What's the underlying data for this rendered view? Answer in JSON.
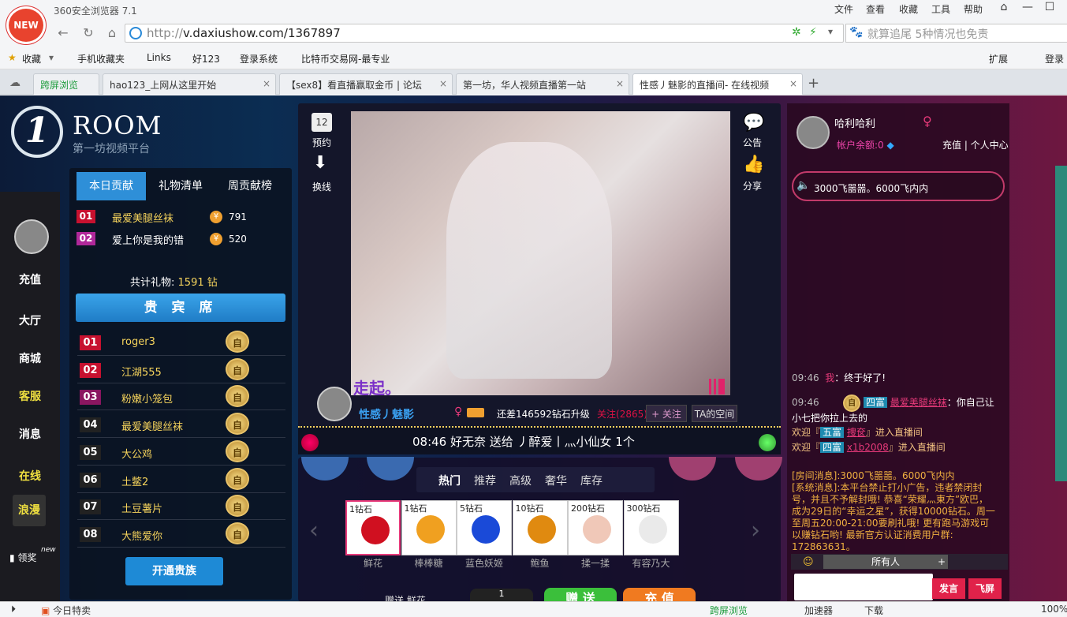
{
  "browser": {
    "app_title": "360安全浏览器 7.1",
    "logo_text": "NEW",
    "menus": [
      "文件",
      "查看",
      "收藏",
      "工具",
      "帮助"
    ],
    "url_prefix": "http://",
    "url_body": "v.daxiushow.com/1367897",
    "search_text": "就算追尾 5种情况也免责",
    "favorites": [
      "收藏",
      "手机收藏夹",
      "Links",
      "好123",
      "登录系统",
      "比特币交易网-最专业"
    ],
    "fav_right": [
      "扩展",
      "登录"
    ],
    "tabs": [
      {
        "label": "跨屏浏览"
      },
      {
        "label": "hao123_上网从这里开始"
      },
      {
        "label": "【sex8】看直播赢取金币 | 论坛"
      },
      {
        "label": "第一坊，华人视频直播第一站"
      },
      {
        "label": "性感丿魅影的直播间- 在线视频"
      }
    ],
    "status": {
      "left": "今日特卖",
      "cross": "跨屏浏览",
      "accel": "加速器",
      "download": "下载",
      "zoom": "100%"
    }
  },
  "site": {
    "logo_glyph": "1",
    "room_title": "ROOM",
    "room_subtitle": "第一坊视频平台",
    "sidebar": [
      "充值",
      "大厅",
      "商城",
      "客服",
      "消息",
      "在线",
      "浪漫",
      "领奖"
    ],
    "sidebar_new": "new"
  },
  "contrib": {
    "tabs": [
      "本日贡献",
      "礼物清单",
      "周贡献榜"
    ],
    "rows": [
      {
        "rank": "01",
        "name": "最爱美腿丝袜",
        "value": "791"
      },
      {
        "rank": "02",
        "name": "爱上你是我的错",
        "value": "520"
      }
    ],
    "coin_glyph": "¥",
    "total_label": "共计礼物:",
    "total_value": "1591",
    "total_unit": "钻",
    "vip_title": "贵 宾 席",
    "vip_badge": "自",
    "vip": [
      {
        "rank": "01",
        "name": "roger3"
      },
      {
        "rank": "02",
        "name": "江湖555"
      },
      {
        "rank": "03",
        "name": "粉嫩小笼包"
      },
      {
        "rank": "04",
        "name": "最爱美腿丝袜"
      },
      {
        "rank": "05",
        "name": "大公鸡"
      },
      {
        "rank": "06",
        "name": "土鳖2"
      },
      {
        "rank": "07",
        "name": "土豆薯片"
      },
      {
        "rank": "08",
        "name": "大熊爱你"
      }
    ],
    "vip_button": "开通贵族"
  },
  "stage": {
    "left_icons": [
      {
        "label": "预约"
      },
      {
        "label": "换线"
      }
    ],
    "right_icons": [
      {
        "label": "公告"
      },
      {
        "label": "分享"
      }
    ],
    "video_caption": "走起。",
    "host_name": "性感丿魅影",
    "upgrade_text": "还差146592钻石升级",
    "follow_text": "关注",
    "follow_count": "(2865)",
    "follow_button": "+ 关注",
    "space_button": "TA的空间",
    "marquee": "08:46  好无奈 送给 丿醉爱丨灬小仙女   1个"
  },
  "gifts": {
    "categories": [
      "热门",
      "推荐",
      "高级",
      "奢华",
      "库存"
    ],
    "items": [
      {
        "price": "1钻石",
        "name": "鲜花",
        "color": "#d01020"
      },
      {
        "price": "1钻石",
        "name": "棒棒糖",
        "color": "#f0a020"
      },
      {
        "price": "5钻石",
        "name": "蓝色妖姬",
        "color": "#1a4ad8"
      },
      {
        "price": "10钻石",
        "name": "鲍鱼",
        "color": "#e08a10"
      },
      {
        "price": "200钻石",
        "name": "揉一揉",
        "color": "#f0c8b8"
      },
      {
        "price": "300钻石",
        "name": "有容乃大",
        "color": "#eaeaea"
      }
    ],
    "send_label": "赠送",
    "send_gift": "鲜花",
    "send_qty": "1",
    "send_button": "赠 送",
    "charge_button": "充 值"
  },
  "chatpanel": {
    "username": "哈利哈利",
    "gender": "♀",
    "balance": "帐户余额:0",
    "links": "充值 | 个人中心",
    "speaker": "3000飞噐噐。6000飞内内",
    "messages": {
      "m1_time": "09:46",
      "m1_name": "我",
      "m1_text": "：终于好了!",
      "m2_time": "09:46",
      "m2_badge": "自",
      "m2_level": "四富",
      "m2_name": "最爱美腿丝袜",
      "m2_text": "：你自己让小七把你拉上去的",
      "m3_pre": "欢迎『",
      "m3_level": "五富",
      "m3_name": "捜奁",
      "m3_post": "』进入直播间",
      "m4_pre": "欢迎『",
      "m4_level": "四富",
      "m4_name": "x1b2008",
      "m4_post": "』进入直播间"
    },
    "system": "[房间消息]:3000飞噐噐。6000飞内内\n[系统消息]:本平台禁止打小广告，违者禁闭封号，并且不予解封哦! 恭喜“荣耀灬東方”欧巴，成为29日的“幸运之星”，获得10000钻石。周一至周五20:00-21:00要刷礼哦! 更有跑马游戏可以赚钻石哟! 最新官方认证消费用户群: 172863631。",
    "audience": "所有人",
    "plus": "+",
    "say_button": "发言",
    "fly_button": "飞屏"
  }
}
